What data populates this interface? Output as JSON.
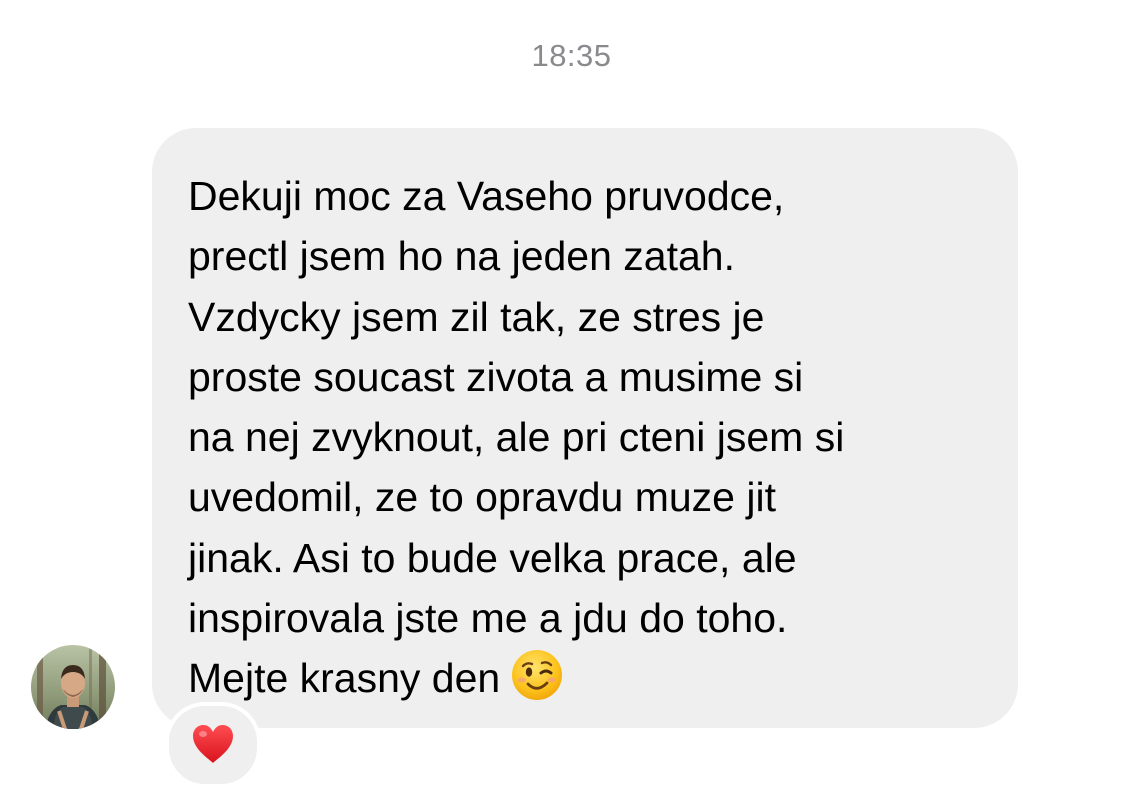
{
  "timestamp": "18:35",
  "message": {
    "lines": [
      "Dekuji moc za Vaseho pruvodce,",
      "prectl jsem ho na jeden zatah.",
      "Vzdycky jsem zil tak, ze stres je",
      "proste soucast zivota a musime si",
      "na nej zvyknout, ale pri cteni jsem si",
      "uvedomil, ze to opravdu muze jit",
      "jinak. Asi to bude velka prace, ale",
      "inspirovala jste me a jdu do toho.",
      "Mejte krasny den"
    ],
    "trailing_emoji": "winking-face-emoji"
  },
  "sender": {
    "avatar_icon": "profile-photo-icon"
  },
  "reaction": {
    "icon": "red-heart-icon",
    "color": "#e8202a"
  },
  "colors": {
    "bubble": "#efefef",
    "timestamp": "#8a8a8e",
    "text": "#000000"
  }
}
